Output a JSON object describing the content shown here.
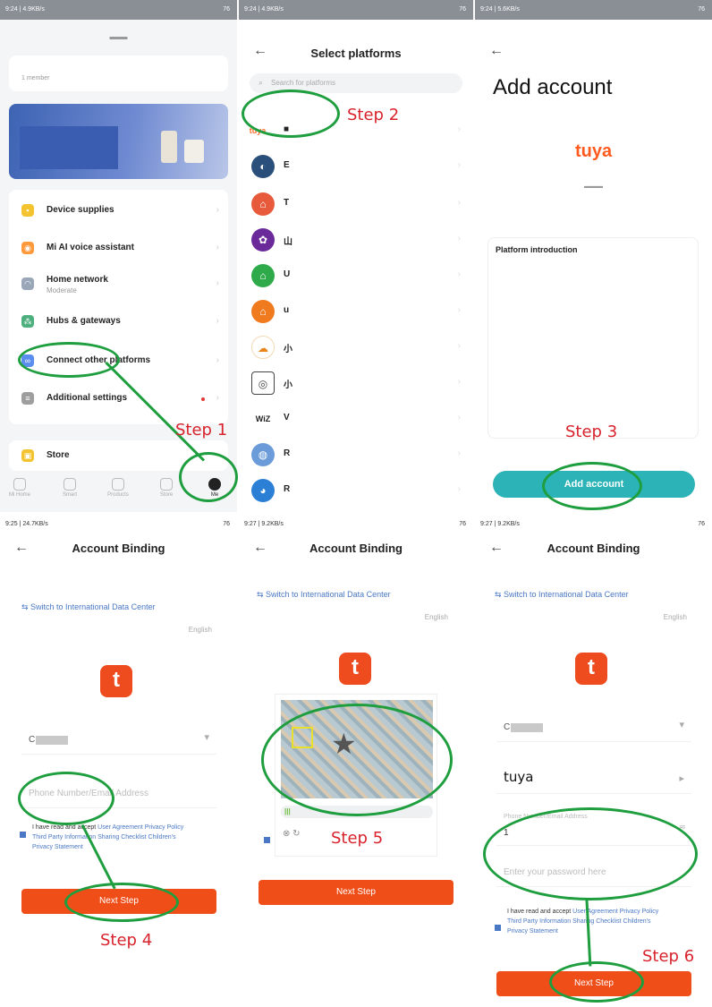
{
  "panel1": {
    "status_left": "9:24 | 4.9KB/s",
    "status_right": "76",
    "home_sub": "1 member",
    "menu": [
      {
        "label": "Device supplies",
        "sub": "",
        "icon": "supplies-icon",
        "color": "#f4c430"
      },
      {
        "label": "Mi AI voice assistant",
        "sub": "",
        "icon": "voice-assistant-icon",
        "color": "#ff9a3c"
      },
      {
        "label": "Home network",
        "sub": "Moderate",
        "icon": "wifi-icon",
        "color": "#9aa7b8"
      },
      {
        "label": "Hubs & gateways",
        "sub": "",
        "icon": "hub-icon",
        "color": "#4caf7d"
      },
      {
        "label": "Connect other platforms",
        "sub": "",
        "icon": "link-icon",
        "color": "#5b8def"
      },
      {
        "label": "Additional settings",
        "sub": "",
        "icon": "settings-icon",
        "color": "#9e9e9e"
      }
    ],
    "store_label": "Store",
    "tabs": [
      "Mi Home",
      "Smart",
      "Products",
      "Store",
      "Me"
    ]
  },
  "panel2": {
    "status_left": "9:24 | 4.9KB/s",
    "status_right": "76",
    "title": "Select platforms",
    "search_placeholder": "Search for platforms",
    "platforms": [
      {
        "initial": "",
        "name": "",
        "color": "#ff6b2c",
        "label": "tuya"
      },
      {
        "initial": "E",
        "name": "E",
        "color": "#2a4f7a",
        "label": ""
      },
      {
        "initial": "T",
        "name": "T",
        "color": "#e85a3c",
        "label": ""
      },
      {
        "initial": "山",
        "name": "山",
        "color": "#6a2a9a",
        "label": ""
      },
      {
        "initial": "U",
        "name": "U",
        "color": "#2eaa4a",
        "label": ""
      },
      {
        "initial": "u",
        "name": "u",
        "color": "#f07a1e",
        "label": ""
      },
      {
        "initial": "小",
        "name": "小",
        "color": "#e8841a",
        "label": ""
      },
      {
        "initial": "小",
        "name": "小",
        "color": "#444444",
        "label": ""
      },
      {
        "initial": "W",
        "name": "V",
        "color": "#ffffff",
        "label": "WiZ"
      },
      {
        "initial": "R",
        "name": "R",
        "color": "#6b9bd8",
        "label": ""
      },
      {
        "initial": "R",
        "name": "R",
        "color": "#2b7fd4",
        "label": ""
      }
    ]
  },
  "panel3": {
    "status_left": "9:24 | 5.6KB/s",
    "status_right": "76",
    "title": "Add account",
    "logo_text": "tuya",
    "intro_label": "Platform introduction",
    "button_label": "Add account"
  },
  "panel4": {
    "status_left": "9:25 | 24.7KB/s",
    "status_right": "76",
    "title": "Account Binding",
    "switch_label": "Switch to International Data Center",
    "language": "English",
    "country_initial": "C",
    "phone_placeholder": "Phone Number/Email Address",
    "agree_prefix": "I have read and accept ",
    "agree_links": "User Agreement Privacy Policy Third Party Information Sharing Checklist Children's Privacy Statement",
    "next_label": "Next Step"
  },
  "panel5": {
    "status_left": "9:27 | 9.2KB/s",
    "status_right": "76",
    "title": "Account Binding",
    "switch_label": "Switch to International Data Center",
    "language": "English",
    "next_label": "Next Step"
  },
  "panel6": {
    "status_left": "9:27 | 9.2KB/s",
    "status_right": "76",
    "title": "Account Binding",
    "switch_label": "Switch to International Data Center",
    "language": "English",
    "country_initial": "C",
    "brand_value": "tuya",
    "phone_label": "Phone Number/Email Address",
    "phone_value": "1",
    "password_placeholder": "Enter your password here",
    "agree_prefix": "I have read and accept ",
    "agree_links": "User Agreement Privacy Policy Third Party Information Sharing Checklist Children's Privacy Statement",
    "next_label": "Next Step"
  },
  "steps": {
    "s1": "Step 1",
    "s2": "Step 2",
    "s3": "Step 3",
    "s4": "Step 4",
    "s5": "Step 5",
    "s6": "Step 6"
  },
  "colors": {
    "annotation": "#1e9e3e",
    "step_text": "#d9232c",
    "tuya_orange": "#f04e18",
    "teal_button": "#2bb3b8",
    "link_blue": "#4a78c5"
  }
}
